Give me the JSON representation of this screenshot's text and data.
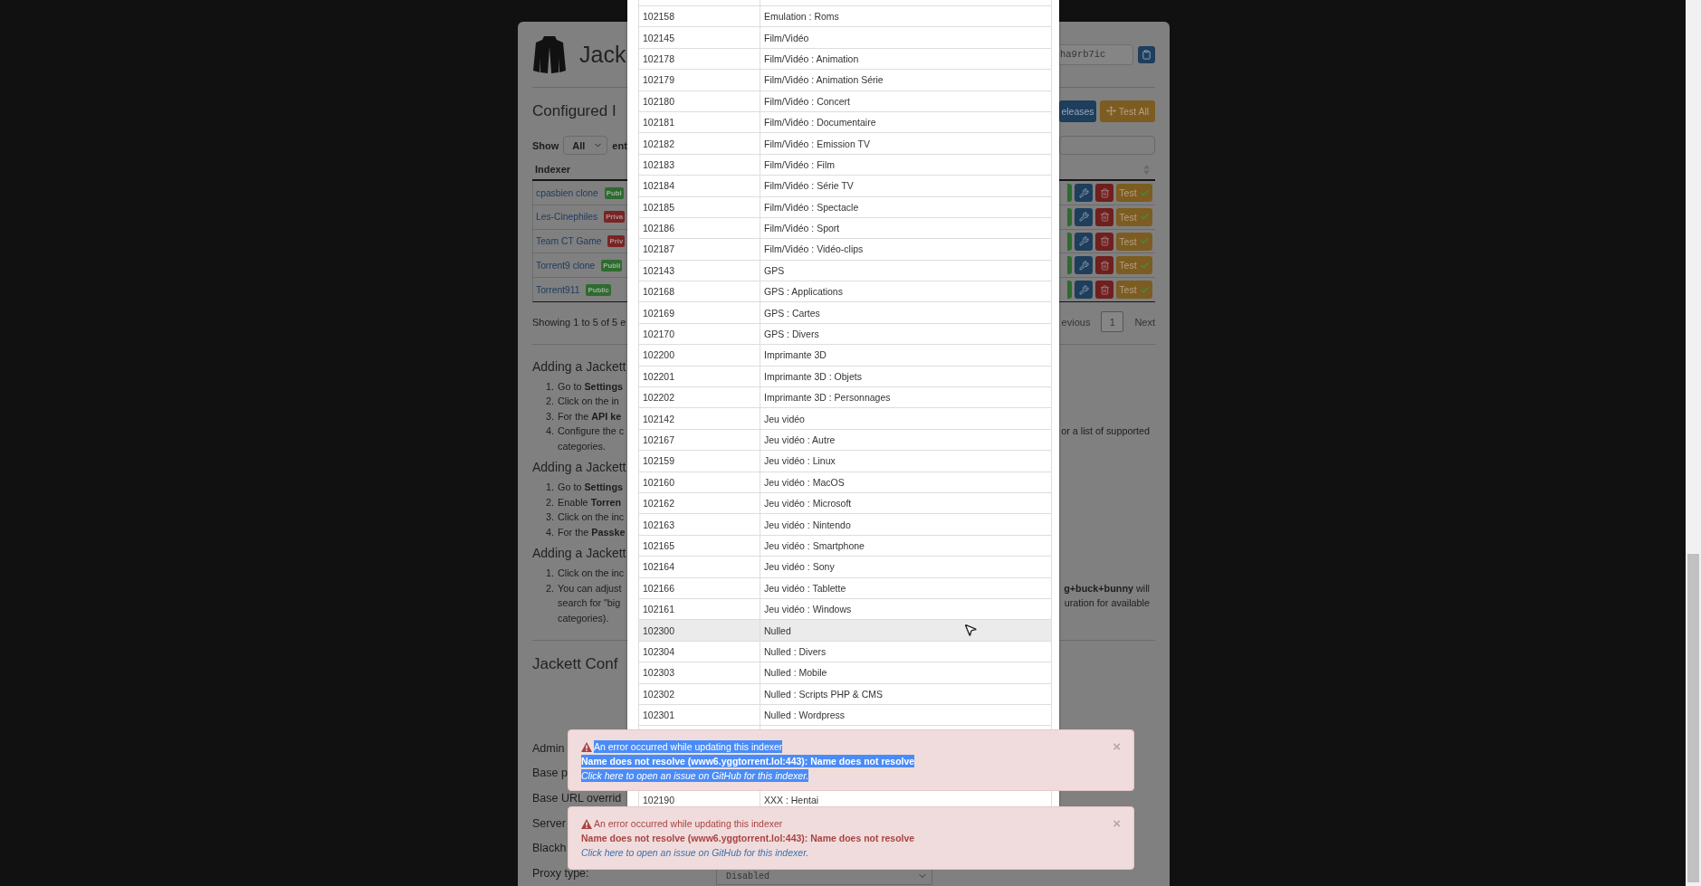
{
  "header": {
    "title": "Jack",
    "api_key": "ha9rb7ic"
  },
  "indexers_panel": {
    "title": "Configured I",
    "buttons": [
      {
        "label": "eleases",
        "kind": "primary"
      },
      {
        "label": "Test All",
        "kind": "warning"
      }
    ],
    "show_label": "Show",
    "page_size": "All",
    "entries_label": "ent",
    "column": "Indexer",
    "rows": [
      {
        "name": "cpasbien clone",
        "badge": "Publ",
        "kind": "public",
        "test": "Test"
      },
      {
        "name": "Les-Cinephiles",
        "badge": "Priva",
        "kind": "private",
        "test": "Test"
      },
      {
        "name": "Team CT Game",
        "badge": "Priv",
        "kind": "private",
        "test": "Test"
      },
      {
        "name": "Torrent9 clone",
        "badge": "Publi",
        "kind": "public",
        "test": "Test"
      },
      {
        "name": "Torrent911",
        "badge": "Public",
        "kind": "public",
        "test": "Test"
      }
    ],
    "info": "Showing 1 to 5 of 5 e",
    "previous": "evious",
    "page": "1",
    "next": "Next"
  },
  "help": [
    {
      "title": "Adding a Jackett",
      "lines": [
        {
          "n": "1.",
          "left": "Go to **Settings**"
        },
        {
          "n": "2.",
          "left": "Click on the in"
        },
        {
          "n": "3.",
          "left": "For the **API ke**"
        },
        {
          "n": "4.",
          "left": "Configure the c",
          "right": "or a list of supported"
        },
        {
          "left": "categories."
        }
      ]
    },
    {
      "title": "Adding a Jackett",
      "lines": [
        {
          "n": "1.",
          "left": "Go to **Settings**"
        },
        {
          "n": "2.",
          "left": "Enable **Torren**"
        },
        {
          "n": "3.",
          "left": "Click on the inc"
        },
        {
          "n": "4.",
          "left": "For the **Passke**"
        }
      ]
    },
    {
      "title": "Adding a Jackett",
      "lines": [
        {
          "n": "1.",
          "left": "Click on the inc"
        },
        {
          "n": "2.",
          "left": "You can adjust",
          "right": "**g+buck+bunny** will"
        },
        {
          "left": "search for \"big",
          "right": "uration for available"
        },
        {
          "left": "categories)."
        }
      ]
    }
  ],
  "config": {
    "title": "Jackett Conf",
    "fields": [
      {
        "label": "Admin"
      },
      {
        "label": "Base p"
      },
      {
        "label": "Base URL overrid"
      },
      {
        "label": "Server"
      },
      {
        "label": "Blackh"
      },
      {
        "label": "Proxy type:",
        "value": "Disabled"
      }
    ]
  },
  "categories": {
    "rows": [
      {
        "id": "102158",
        "name": "Emulation : Roms",
        "hovered": false
      },
      {
        "id": "102145",
        "name": "Film/Vidéo",
        "hovered": false
      },
      {
        "id": "102178",
        "name": "Film/Vidéo : Animation",
        "hovered": false
      },
      {
        "id": "102179",
        "name": "Film/Vidéo : Animation Série",
        "hovered": false
      },
      {
        "id": "102180",
        "name": "Film/Vidéo : Concert",
        "hovered": false
      },
      {
        "id": "102181",
        "name": "Film/Vidéo : Documentaire",
        "hovered": false
      },
      {
        "id": "102182",
        "name": "Film/Vidéo : Emission TV",
        "hovered": false
      },
      {
        "id": "102183",
        "name": "Film/Vidéo : Film",
        "hovered": false
      },
      {
        "id": "102184",
        "name": "Film/Vidéo : Série TV",
        "hovered": false
      },
      {
        "id": "102185",
        "name": "Film/Vidéo : Spectacle",
        "hovered": false
      },
      {
        "id": "102186",
        "name": "Film/Vidéo : Sport",
        "hovered": false
      },
      {
        "id": "102187",
        "name": "Film/Vidéo : Vidéo-clips",
        "hovered": false
      },
      {
        "id": "102143",
        "name": "GPS",
        "hovered": false
      },
      {
        "id": "102168",
        "name": "GPS : Applications",
        "hovered": false
      },
      {
        "id": "102169",
        "name": "GPS : Cartes",
        "hovered": false
      },
      {
        "id": "102170",
        "name": "GPS : Divers",
        "hovered": false
      },
      {
        "id": "102200",
        "name": "Imprimante 3D",
        "hovered": false
      },
      {
        "id": "102201",
        "name": "Imprimante 3D : Objets",
        "hovered": false
      },
      {
        "id": "102202",
        "name": "Imprimante 3D : Personnages",
        "hovered": false
      },
      {
        "id": "102142",
        "name": "Jeu vidéo",
        "hovered": false
      },
      {
        "id": "102167",
        "name": "Jeu vidéo : Autre",
        "hovered": false
      },
      {
        "id": "102159",
        "name": "Jeu vidéo : Linux",
        "hovered": false
      },
      {
        "id": "102160",
        "name": "Jeu vidéo : MacOS",
        "hovered": false
      },
      {
        "id": "102162",
        "name": "Jeu vidéo : Microsoft",
        "hovered": false
      },
      {
        "id": "102163",
        "name": "Jeu vidéo : Nintendo",
        "hovered": false
      },
      {
        "id": "102165",
        "name": "Jeu vidéo : Smartphone",
        "hovered": false
      },
      {
        "id": "102164",
        "name": "Jeu vidéo : Sony",
        "hovered": false
      },
      {
        "id": "102166",
        "name": "Jeu vidéo : Tablette",
        "hovered": false
      },
      {
        "id": "102161",
        "name": "Jeu vidéo : Windows",
        "hovered": false
      },
      {
        "id": "102300",
        "name": "Nulled",
        "hovered": true
      },
      {
        "id": "102304",
        "name": "Nulled : Divers",
        "hovered": false
      },
      {
        "id": "102303",
        "name": "Nulled : Mobile",
        "hovered": false
      },
      {
        "id": "102302",
        "name": "Nulled : Scripts PHP & CMS",
        "hovered": false
      },
      {
        "id": "102301",
        "name": "Nulled : Wordpress",
        "hovered": false
      }
    ],
    "rows_below": [
      {
        "id": "102190",
        "name": "XXX : Hentai",
        "hovered": false
      }
    ]
  },
  "notifications": [
    {
      "title": "An error occurred while updating this indexer",
      "message": "Name does not resolve (www6.yggtorrent.lol:443): Name does not resolve",
      "link": "Click here to open an issue on GitHub for this indexer.",
      "close": "×",
      "text_selected": true
    },
    {
      "title": "An error occurred while updating this indexer",
      "message": "Name does not resolve (www6.yggtorrent.lol:443): Name does not resolve",
      "link": "Click here to open an issue on GitHub for this indexer.",
      "close": "×",
      "text_selected": false
    }
  ]
}
